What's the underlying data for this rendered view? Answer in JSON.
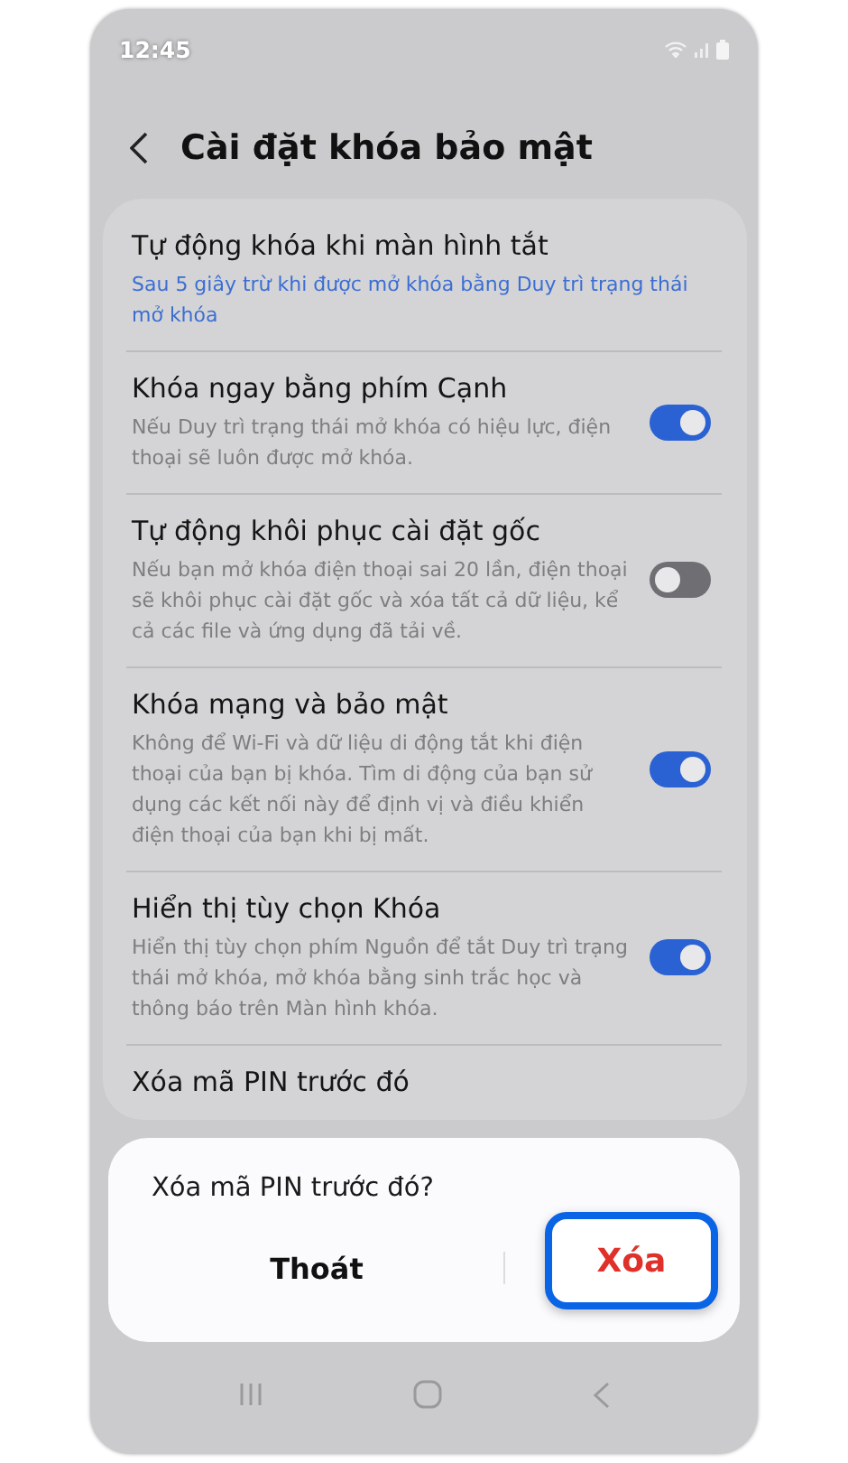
{
  "status_bar": {
    "time": "12:45"
  },
  "header": {
    "title": "Cài đặt khóa bảo mật"
  },
  "settings": [
    {
      "kind": "link",
      "title": "Tự động khóa khi màn hình tắt",
      "subtitle": "Sau 5 giây trừ khi được mở khóa bằng Duy trì trạng thái mở khóa"
    },
    {
      "kind": "toggle",
      "title": "Khóa ngay bằng phím Cạnh",
      "subtitle": "Nếu Duy trì trạng thái mở khóa có hiệu lực, điện thoại sẽ luôn được mở khóa.",
      "on": true
    },
    {
      "kind": "toggle",
      "title": "Tự động khôi phục cài đặt gốc",
      "subtitle": "Nếu bạn mở khóa điện thoại sai 20 lần, điện thoại sẽ khôi phục cài đặt gốc và xóa tất cả dữ liệu, kể cả các file và ứng dụng đã tải về.",
      "on": false
    },
    {
      "kind": "toggle",
      "title": "Khóa mạng và bảo mật",
      "subtitle": "Không để Wi-Fi và dữ liệu di động tắt khi điện thoại của bạn bị khóa. Tìm di động của bạn sử dụng các kết nối này để định vị và điều khiển điện thoại của bạn khi bị mất.",
      "on": true
    },
    {
      "kind": "toggle",
      "title": "Hiển thị tùy chọn Khóa",
      "subtitle": "Hiển thị tùy chọn phím Nguồn để tắt Duy trì trạng thái mở khóa, mở khóa bằng sinh trắc học và thông báo trên Màn hình khóa.",
      "on": true
    },
    {
      "kind": "plain",
      "title": "Xóa mã PIN trước đó"
    }
  ],
  "dialog": {
    "message": "Xóa mã PIN trước đó?",
    "buttons": [
      {
        "label": "Thoát",
        "kind": "cancel"
      },
      {
        "label": "Xóa",
        "kind": "destructive"
      }
    ]
  }
}
